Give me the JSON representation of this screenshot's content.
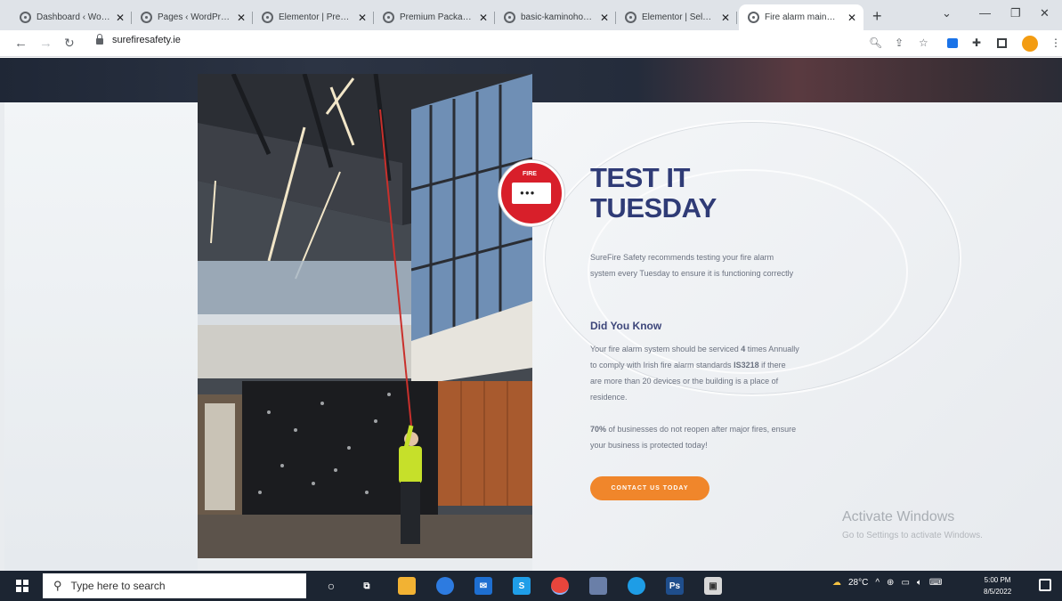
{
  "browser": {
    "tabs": [
      {
        "title": "Dashboard ‹ Wo…"
      },
      {
        "title": "Pages ‹ WordPr…"
      },
      {
        "title": "Elementor | Pre…"
      },
      {
        "title": "Premium Packa…"
      },
      {
        "title": "basic-kaminoho…"
      },
      {
        "title": "Elementor | Sel…"
      },
      {
        "title": "Fire alarm main…",
        "active": true
      }
    ],
    "new_tab": "+",
    "url": "surefiresafety.ie"
  },
  "page": {
    "heading_line1": "TEST IT",
    "heading_line2": "TUESDAY",
    "intro": "SureFire Safety recommends testing your fire alarm system every Tuesday to ensure it is functioning correctly",
    "did_you_know": "Did You Know",
    "service_text_a": "Your fire alarm system should be serviced ",
    "service_bold_4": "4",
    "service_text_b": " times Annually to comply with Irish fire alarm standards ",
    "service_bold_is": "IS3218",
    "service_text_c": " if there are more than 20 devices or the building is a place of residence.",
    "stat_bold": "70%",
    "stat_text": " of businesses do not reopen after major fires, ensure your business is protected today!",
    "cta": "CONTACT US TODAY",
    "badge_text": "FIRE",
    "activate_title": "Activate Windows",
    "activate_sub": "Go to Settings to activate Windows."
  },
  "taskbar": {
    "search_placeholder": "Type here to search",
    "weather": "28°C",
    "time": "5:00 PM",
    "date": "8/5/2022"
  },
  "colors": {
    "heading": "#2f3b76",
    "cta": "#f0862b",
    "badge": "#d81f2a"
  }
}
